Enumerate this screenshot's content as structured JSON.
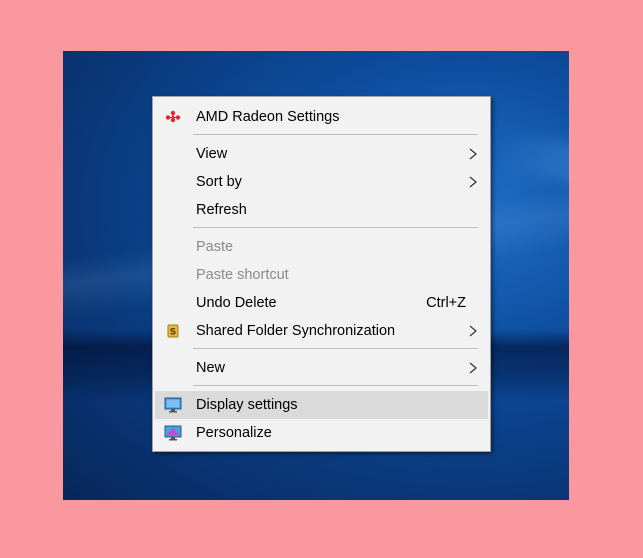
{
  "context_menu": {
    "amd": {
      "label": "AMD Radeon Settings",
      "icon": "amd-radeon-icon",
      "icon_color": "#e0282e"
    },
    "view": {
      "label": "View"
    },
    "sort_by": {
      "label": "Sort by"
    },
    "refresh": {
      "label": "Refresh"
    },
    "paste": {
      "label": "Paste"
    },
    "paste_shortcut": {
      "label": "Paste shortcut"
    },
    "undo_delete": {
      "label": "Undo Delete",
      "shortcut": "Ctrl+Z"
    },
    "shared_folder_sync": {
      "label": "Shared Folder Synchronization",
      "icon": "shared-folder-sync-icon"
    },
    "new": {
      "label": "New"
    },
    "display_settings": {
      "label": "Display settings",
      "icon": "display-settings-icon"
    },
    "personalize": {
      "label": "Personalize",
      "icon": "personalize-icon"
    }
  },
  "colors": {
    "page_background": "#f9999f",
    "menu_background": "#f2f2f2",
    "hover_background": "#dadada",
    "disabled_text": "#8a8a8a"
  }
}
